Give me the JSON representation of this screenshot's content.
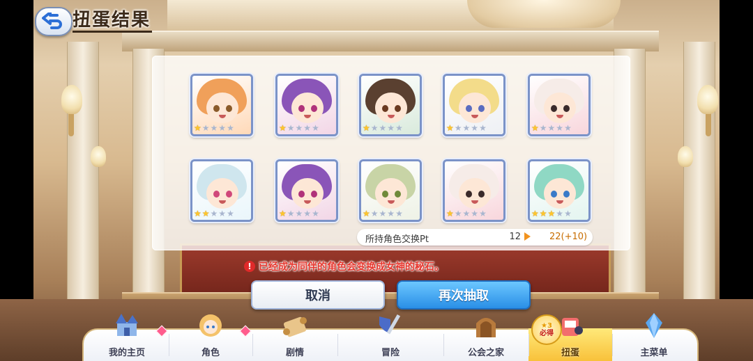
{
  "header": {
    "title": "扭蛋结果"
  },
  "results": {
    "cards": [
      {
        "stars": 1,
        "hair": "#f0a05a",
        "bg": "#ffd9b8",
        "eye": "#8a5a2a"
      },
      {
        "stars": 1,
        "hair": "#8a55b8",
        "bg": "#f2d6e6",
        "eye": "#b0327a"
      },
      {
        "stars": 1,
        "hair": "#5a4030",
        "bg": "#d9eadc",
        "eye": "#6a3a20"
      },
      {
        "stars": 1,
        "hair": "#f3dc8a",
        "bg": "#eef0f4",
        "eye": "#5a6cc0"
      },
      {
        "stars": 1,
        "hair": "#f6ece8",
        "bg": "#f8d6dc",
        "eye": "#3a2a2a"
      },
      {
        "stars": 2,
        "hair": "#cfe6ee",
        "bg": "#eaf6fb",
        "eye": "#d0487a"
      },
      {
        "stars": 1,
        "hair": "#8a55b8",
        "bg": "#f2d6e6",
        "eye": "#b0327a"
      },
      {
        "stars": 1,
        "hair": "#c8d4a6",
        "bg": "#eef2e6",
        "eye": "#6f8a3a"
      },
      {
        "stars": 1,
        "hair": "#f6ece8",
        "bg": "#f8d6dc",
        "eye": "#3a2a2a"
      },
      {
        "stars": 3,
        "hair": "#8fd8c4",
        "bg": "#e4f5f0",
        "eye": "#3a7ac8"
      }
    ]
  },
  "exchange_pt": {
    "label": "所持角色交换Pt",
    "current": "12",
    "after": "22(+10)"
  },
  "notice": {
    "icon": "!",
    "text": "已经成为同伴的角色会变换成女神的秘石。"
  },
  "buttons": {
    "cancel": "取消",
    "redraw": "再次抽取"
  },
  "nav": {
    "items": [
      {
        "label": "我的主页",
        "icon": "castle-icon",
        "badge": true
      },
      {
        "label": "角色",
        "icon": "character-icon",
        "badge": true
      },
      {
        "label": "剧情",
        "icon": "scroll-icon",
        "badge": false
      },
      {
        "label": "冒险",
        "icon": "sword-shield-icon",
        "badge": false
      },
      {
        "label": "公会之家",
        "icon": "guild-door-icon",
        "badge": false
      },
      {
        "label": "扭蛋",
        "icon": "gacha-icon",
        "badge": false,
        "active": true
      },
      {
        "label": "主菜单",
        "icon": "crystal-icon",
        "badge": false
      }
    ],
    "gacha_badge": {
      "star": "★3",
      "text": "必得"
    }
  },
  "colors": {
    "accent_blue": "#2a8fe6",
    "notice_red": "#e6372e",
    "star_gold": "#ffc62b",
    "active_tab": "#f8c13a"
  }
}
